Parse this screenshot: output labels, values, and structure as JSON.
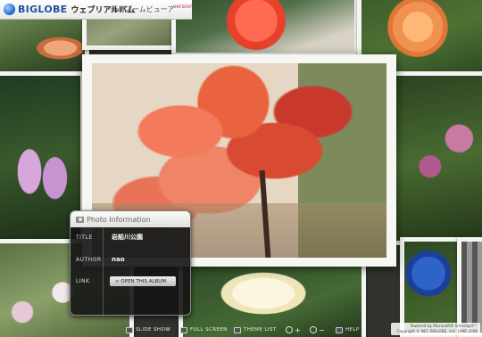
{
  "header": {
    "logo": "BIGLOBE",
    "app_name": "ウェブリアルバム",
    "subtitle": "新着ズームビューア",
    "version": "version"
  },
  "info": {
    "heading": "Photo Information",
    "title_key": "TITLE",
    "title_value": "岩船川公園",
    "author_key": "AUTHOR",
    "author_value": "nao",
    "link_key": "LINK",
    "link_button": "> OPEN THIS ALBUM"
  },
  "toolbar": {
    "slideshow": "SLIDE SHOW",
    "fullscreen": "FULL SCREEN",
    "themelist": "THEME LIST",
    "zoom_in": "+",
    "zoom_out": "−",
    "help": "HELP"
  },
  "footer": {
    "powered": "Powered by Microsoft® Silverlight™",
    "copyright": "Copyright © NEC BIGLOBE, Ltd. 1996-2008"
  }
}
